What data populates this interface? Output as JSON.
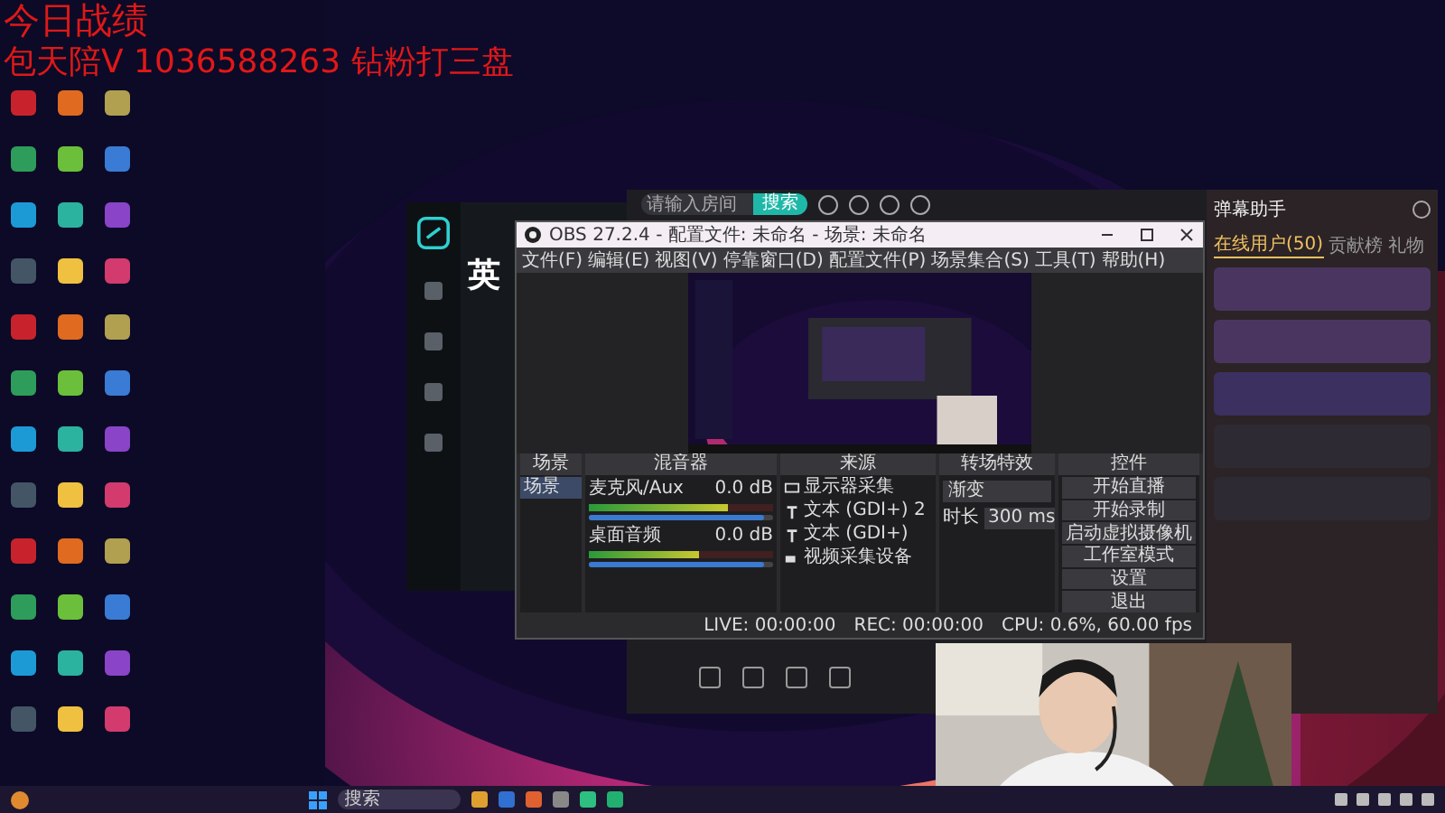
{
  "overlay": {
    "title": "今日战绩",
    "line": "包天陪V 1036588263 钻粉打三盘"
  },
  "game_client": {
    "heading": "英"
  },
  "stream_app": {
    "search_placeholder": "请输入房间",
    "search_button": "搜索"
  },
  "obs": {
    "title": "OBS 27.2.4 - 配置文件: 未命名 - 场景: 未命名",
    "menu": [
      "文件(F)",
      "编辑(E)",
      "视图(V)",
      "停靠窗口(D)",
      "配置文件(P)",
      "场景集合(S)",
      "工具(T)",
      "帮助(H)"
    ],
    "docks": [
      "场景",
      "混音器",
      "来源",
      "转场特效",
      "控件"
    ],
    "scenes": [
      {
        "label": "场景",
        "selected": true
      }
    ],
    "mixer": [
      {
        "name": "麦克风/Aux",
        "reading": "0.0 dB",
        "level": 0.75,
        "volume_slider": {
          "level": 0.95
        }
      },
      {
        "name": "桌面音频",
        "reading": "0.0 dB",
        "level": 0.6,
        "volume_slider": {
          "level": 0.95
        }
      }
    ],
    "sources": [
      {
        "label": "显示器采集",
        "kind": "display"
      },
      {
        "label": "文本 (GDI+) 2",
        "kind": "text"
      },
      {
        "label": "文本 (GDI+)",
        "kind": "text"
      },
      {
        "label": "视频采集设备",
        "kind": "camera"
      }
    ],
    "transition": {
      "value": "渐变",
      "duration_label": "时长",
      "duration": "300 ms"
    },
    "controls": [
      "开始直播",
      "开始录制",
      "启动虚拟摄像机",
      "工作室模式",
      "设置",
      "退出"
    ],
    "status": [
      "LIVE: 00:00:00",
      "REC: 00:00:00",
      "CPU: 0.6%, 60.00 fps"
    ]
  },
  "chat": {
    "header": "弹幕助手",
    "tabs": [
      {
        "label": "在线用户(50)",
        "selected": true
      },
      {
        "label": "贡献榜",
        "selected": false
      },
      {
        "label": "礼物",
        "selected": false
      }
    ]
  },
  "taskbar": {
    "search_placeholder": "搜索"
  }
}
